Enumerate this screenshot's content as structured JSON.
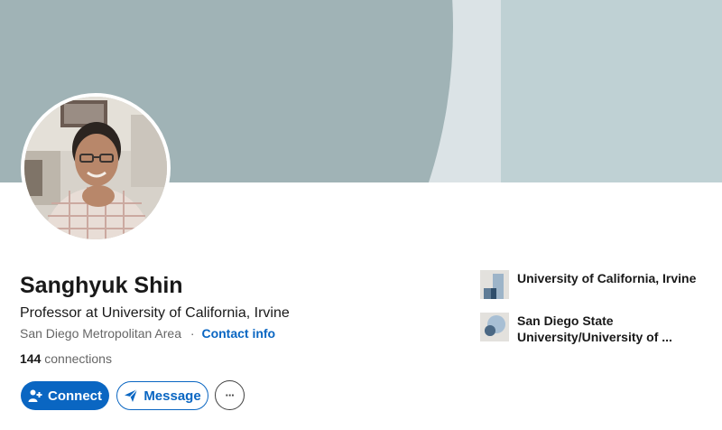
{
  "profile": {
    "name": "Sanghyuk Shin",
    "headline": "Professor at University of California, Irvine",
    "location": "San Diego Metropolitan Area",
    "separator": "·",
    "contact_info_label": "Contact info",
    "connections_count": "144",
    "connections_label": "connections"
  },
  "actions": {
    "connect_label": "Connect",
    "message_label": "Message",
    "more_label": "···"
  },
  "organizations": [
    {
      "name": "University of California, Irvine",
      "icon": "company-logo-icon"
    },
    {
      "name": "San Diego State University/University of ...",
      "icon": "school-logo-icon"
    }
  ],
  "colors": {
    "accent": "#0a66c2",
    "banner_light": "#dbe3e6",
    "banner_dark": "#a0b3b6",
    "banner_panel": "#bfd1d4"
  }
}
